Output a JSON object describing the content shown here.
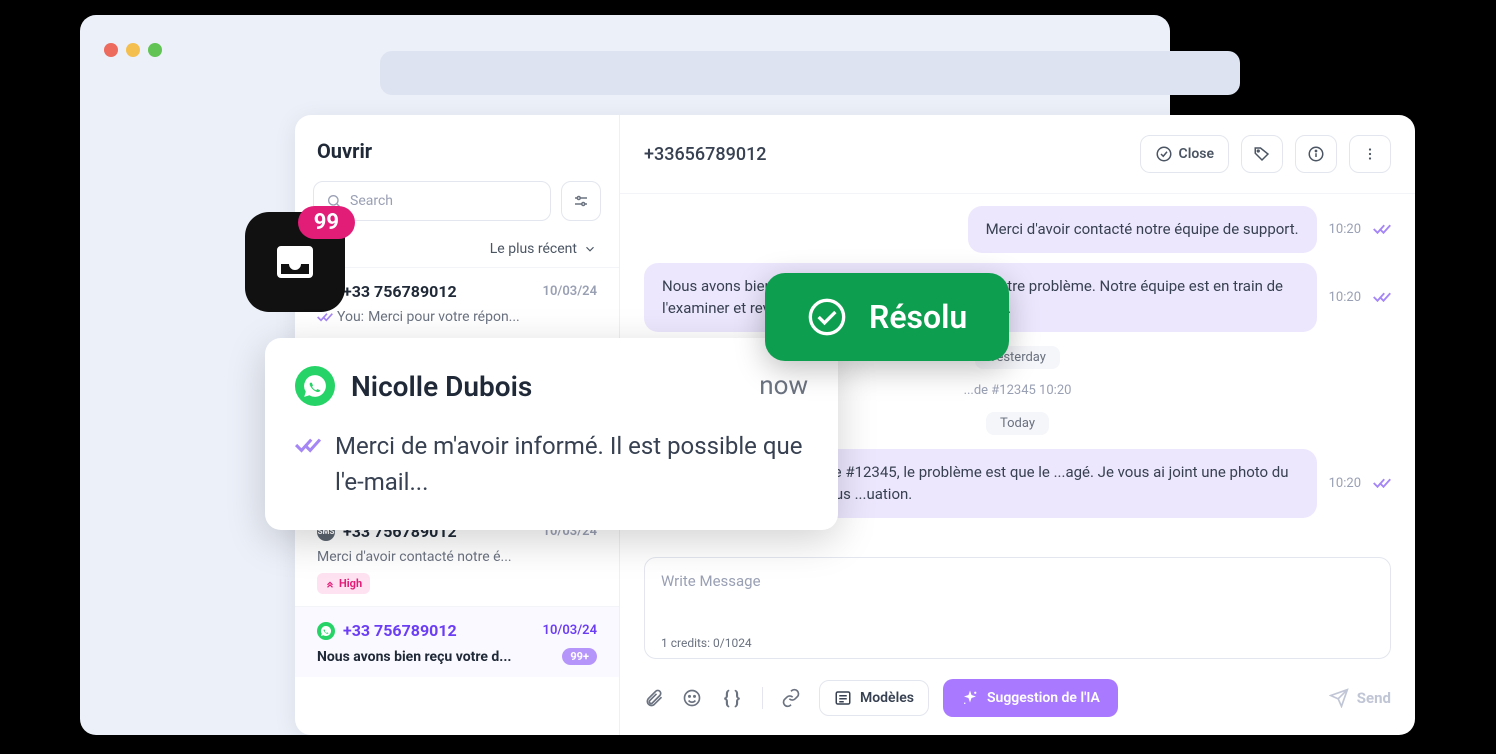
{
  "window": {
    "url_bar": ""
  },
  "sidebar": {
    "title": "Ouvrir",
    "search_placeholder": "Search",
    "sort_label": "Le plus récent"
  },
  "conversations": [
    {
      "channel": "sms",
      "name": "+33 756789012",
      "date": "10/03/24",
      "preview_prefix": "You:",
      "preview": "Merci pour votre répon...",
      "active": false
    },
    {
      "channel": "sms",
      "name": "+33 756789012",
      "date": "10/03/24",
      "preview": "Merci d'avoir contacté notre é...",
      "priority": "High"
    },
    {
      "channel": "wa",
      "name": "+33 756789012",
      "date": "10/03/24",
      "preview": "Nous avons bien reçu votre d...",
      "active": true,
      "badge": "99+"
    }
  ],
  "header": {
    "title": "+33656789012",
    "close_label": "Close"
  },
  "messages": [
    {
      "text": "Merci d'avoir contacté notre équipe de support.",
      "time": "10:20",
      "outgoing": true
    },
    {
      "text": "Nous avons bien reçu votre demande concernant votre problème. Notre équipe est en train de l'examiner et reviendra vers vous dans les 24 heures.",
      "time": "10:20",
      "outgoing": true
    },
    {
      "separator": "Yesterday"
    },
    {
      "system": "...de #12345   10:20"
    },
    {
      "separator": "Today"
    },
    {
      "text": ". Concernant la commande #12345, le problème est que le ...agé. Je vous ai joint une photo du colis et du produit pour vous ...uation.",
      "time": "10:20",
      "outgoing": true
    }
  ],
  "composer": {
    "placeholder": "Write Message",
    "credits": "1 credits: 0/1024"
  },
  "toolbar": {
    "models_label": "Modèles",
    "ai_label": "Suggestion de l'IA",
    "send_label": "Send"
  },
  "inbox_badge": "99",
  "popup": {
    "name": "Nicolle Dubois",
    "time": "now",
    "message": "Merci de m'avoir informé. Il est possible que l'e-mail..."
  },
  "resolved": {
    "label": "Résolu"
  }
}
